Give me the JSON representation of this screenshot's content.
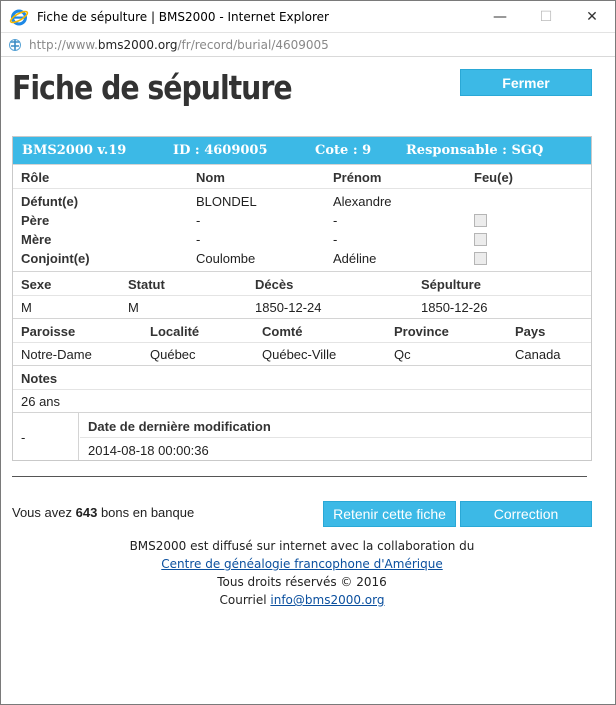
{
  "window": {
    "title": "Fiche de sépulture | BMS2000 - Internet Explorer",
    "minimize": "—",
    "maximize": "☐",
    "close": "✕"
  },
  "address": {
    "prefix": "http://www.",
    "host": "bms2000.org",
    "path": "/fr/record/burial/4609005"
  },
  "page": {
    "title": "Fiche de sépulture",
    "close_button": "Fermer"
  },
  "record_header": {
    "version": "BMS2000 v.19",
    "id": "ID : 4609005",
    "cote": "Cote : 9",
    "responsable": "Responsable : SGQ"
  },
  "persons": {
    "headers": {
      "role": "Rôle",
      "nom": "Nom",
      "prenom": "Prénom",
      "feu": "Feu(e)"
    },
    "rows": [
      {
        "role": "Défunt(e)",
        "nom": "BLONDEL",
        "prenom": "Alexandre"
      },
      {
        "role": "Père",
        "nom": "-",
        "prenom": "-"
      },
      {
        "role": "Mère",
        "nom": "-",
        "prenom": "-"
      },
      {
        "role": "Conjoint(e)",
        "nom": "Coulombe",
        "prenom": "Adéline"
      }
    ]
  },
  "details": {
    "headers": {
      "sexe": "Sexe",
      "statut": "Statut",
      "deces": "Décès",
      "sepulture": "Sépulture"
    },
    "values": {
      "sexe": "M",
      "statut": "M",
      "deces": "1850-12-24",
      "sepulture": "1850-12-26"
    }
  },
  "place": {
    "headers": {
      "paroisse": "Paroisse",
      "localite": "Localité",
      "comte": "Comté",
      "province": "Province",
      "pays": "Pays"
    },
    "values": {
      "paroisse": "Notre-Dame",
      "localite": "Québec",
      "comte": "Québec-Ville",
      "province": "Qc",
      "pays": "Canada"
    }
  },
  "notes": {
    "header": "Notes",
    "value": "26 ans"
  },
  "modification": {
    "dash": "-",
    "header": "Date de dernière modification",
    "value": "2014-08-18 00:00:36"
  },
  "bank": {
    "prefix": "Vous avez",
    "count": "643",
    "suffix": "bons en banque"
  },
  "actions": {
    "retain": "Retenir cette fiche",
    "correction": "Correction"
  },
  "footer": {
    "line1": "BMS2000 est diffusé sur internet avec la collaboration du",
    "link1": "Centre de généalogie francophone d'Amérique",
    "line3": "Tous droits réservés © 2016",
    "courriel_label": "Courriel",
    "email": "info@bms2000.org"
  },
  "colors": {
    "accent": "#3cb9e6",
    "link": "#0a4f9e"
  },
  "icons": [
    "internet-explorer-icon",
    "page-icon"
  ]
}
